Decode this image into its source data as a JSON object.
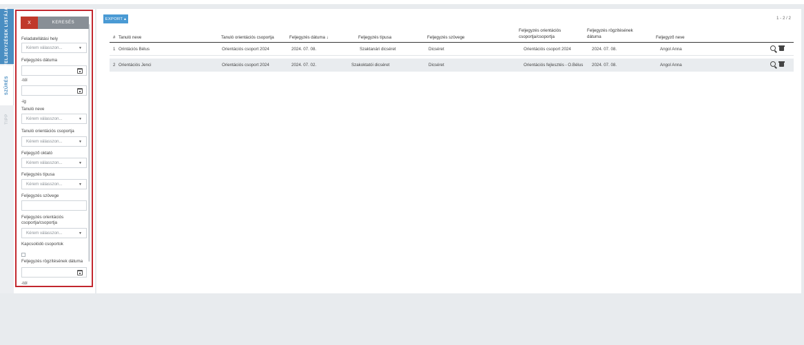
{
  "side_tabs": {
    "list": "FELJEGYZÉSEK LISTÁJA",
    "filter": "SZŰRÉS",
    "tips": "TIPP"
  },
  "filter": {
    "clear_label": "X",
    "search_label": "KERESÉS",
    "placeholder": "Kérem válasszon...",
    "fields": {
      "task_location": "Feladatellátási hely",
      "note_date": "Feljegyzés dátuma",
      "from": "-tól",
      "to": "-ig",
      "student_name": "Tanuló neve",
      "student_group": "Tanuló orientációs csoportja",
      "teacher": "Feljegyző oktató",
      "note_type": "Feljegyzés típusa",
      "note_text": "Feljegyzés szövege",
      "note_group_line1": "Feljegyzés orientációs",
      "note_group_line2": "csoportja/csoportja",
      "related_groups": "Kapcsolódó csoportok",
      "record_date": "Feljegyzés rögzítésének dátuma",
      "from2": "-tól"
    }
  },
  "toolbar": {
    "export_label": "EXPORT ▴",
    "pager": "1 - 2 / 2"
  },
  "table": {
    "headers": {
      "num": "#",
      "name": "Tanuló neve",
      "group": "Tanuló orientációs csoportja",
      "date": "Feljegyzés dátuma ↓",
      "type": "Feljegyzés típusa",
      "text": "Feljegyzés szövege",
      "note_group_1": "Feljegyzés orientációs",
      "note_group_2": "csoportja/csoportja",
      "rec_date_1": "Feljegyzés rögzítésének",
      "rec_date_2": "dátuma",
      "author": "Feljegyző neve"
    },
    "rows": [
      {
        "num": "1",
        "name": "Orintációs Bélus",
        "group": "Orientációs csoport 2024",
        "date": "2024. 07. 08.",
        "type": "Szaktanári dicséret",
        "text": "Dicséret",
        "note_group": "Orientációs csoport 2024",
        "rec_date": "2024. 07. 08.",
        "author": "Angol Anna"
      },
      {
        "num": "2",
        "name": "Orientációs Jenci",
        "group": "Orientációs csoport 2024",
        "date": "2024. 07. 02.",
        "type": "Szakoktatói dicséret",
        "text": "Dicséret",
        "note_group": "Orientációs fejlesztés - O.Bélus",
        "rec_date": "2024. 07. 08.",
        "author": "Angol Anna"
      }
    ]
  }
}
